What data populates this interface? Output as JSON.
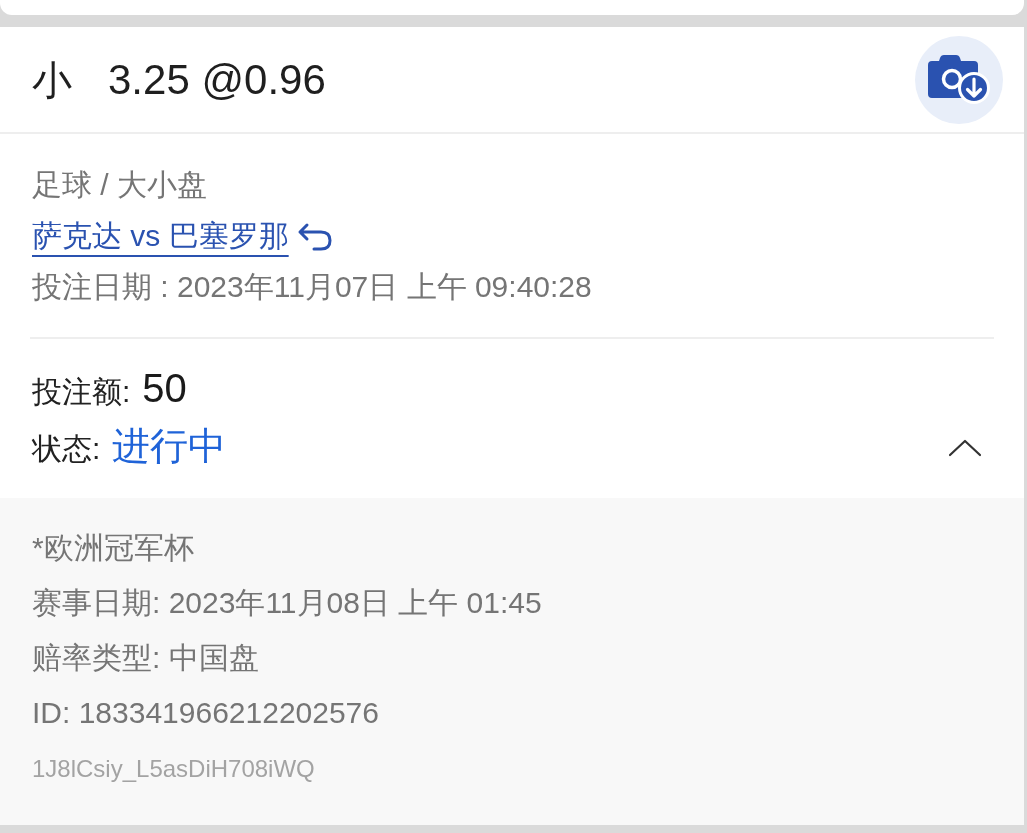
{
  "bet": {
    "selection": "小",
    "odds": "3.25 @0.96"
  },
  "info": {
    "category": "足球 / 大小盘",
    "match": "萨克达 vs 巴塞罗那",
    "bet_date": "投注日期 : 2023年11月07日 上午 09:40:28"
  },
  "summary": {
    "stake_label": "投注额:",
    "stake": "50",
    "status_label": "状态:",
    "status": "进行中",
    "expanded": true
  },
  "details": {
    "lines": [
      "*欧洲冠军杯",
      "赛事日期: 2023年11月08日 上午 01:45",
      "赔率类型: 中国盘",
      "ID: 183341966212202576"
    ],
    "reference": "1J8lCsiy_L5asDiH708iWQ"
  }
}
